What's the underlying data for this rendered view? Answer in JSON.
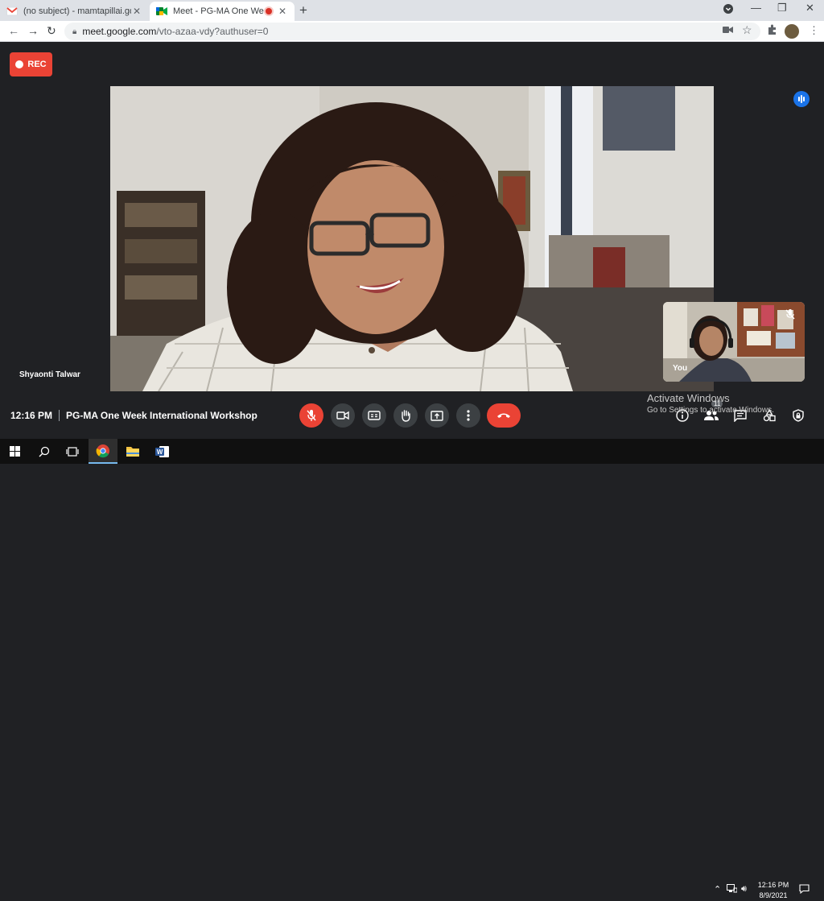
{
  "browser": {
    "tabs": [
      {
        "title": "(no subject) - mamtapillai.gd@in",
        "favicon": "gmail-icon"
      },
      {
        "title": "Meet - PG-MA One Week Int",
        "favicon": "meet-icon",
        "recording": true
      }
    ],
    "url_domain": "meet.google.com",
    "url_path": "/vto-azaa-vdy?authuser=0"
  },
  "meet": {
    "rec_label": "REC",
    "speaker_name": "Shyaonti Talwar",
    "self_label": "You",
    "time": "12:16 PM",
    "meeting_title": "PG-MA One Week International Workshop",
    "participants_count": "11",
    "colors": {
      "accent_red": "#ea4335",
      "button_bg": "#3c4043",
      "speaking_blue": "#1a73e8",
      "stage_bg": "#202124"
    }
  },
  "watermark": {
    "line1": "Activate Windows",
    "line2": "Go to Settings to activate Windows."
  },
  "taskbar": {
    "time": "12:16 PM",
    "date": "8/9/2021"
  }
}
